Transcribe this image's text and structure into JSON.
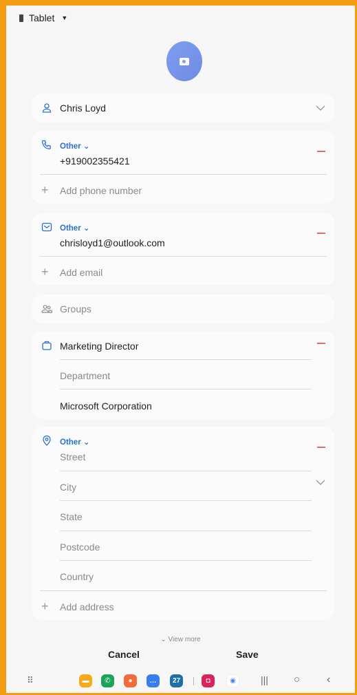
{
  "header": {
    "storage_label": "Tablet"
  },
  "name": {
    "value": "Chris Loyd"
  },
  "phone": {
    "type": "Other",
    "value": "+919002355421",
    "add_label": "Add phone number"
  },
  "email": {
    "type": "Other",
    "value": "chrisloyd1@outlook.com",
    "add_label": "Add email"
  },
  "groups": {
    "label": "Groups"
  },
  "organization": {
    "job_title": "Marketing Director",
    "department_placeholder": "Department",
    "company": "Microsoft Corporation"
  },
  "address": {
    "type": "Other",
    "street_placeholder": "Street",
    "city_placeholder": "City",
    "state_placeholder": "State",
    "postcode_placeholder": "Postcode",
    "country_placeholder": "Country",
    "add_label": "Add address"
  },
  "view_more": "View more",
  "actions": {
    "cancel": "Cancel",
    "save": "Save"
  },
  "colors": {
    "accent": "#2a6fd1",
    "remove": "#e46969",
    "frame": "#f39c12",
    "avatar": "#7e9ef0"
  },
  "dock": {
    "date_badge": "27",
    "apps": [
      {
        "name": "my-files-app",
        "color": "#f7a81b"
      },
      {
        "name": "phone-app",
        "color": "#1aa35b"
      },
      {
        "name": "contacts-app",
        "color": "#f26b3a"
      },
      {
        "name": "messages-app",
        "color": "#3b7df0"
      },
      {
        "name": "calendar-app",
        "color": "#1e6fa8"
      },
      {
        "name": "camera-app",
        "color": "#d8245b"
      },
      {
        "name": "google-lens-app",
        "color": "#ffffff"
      }
    ]
  }
}
